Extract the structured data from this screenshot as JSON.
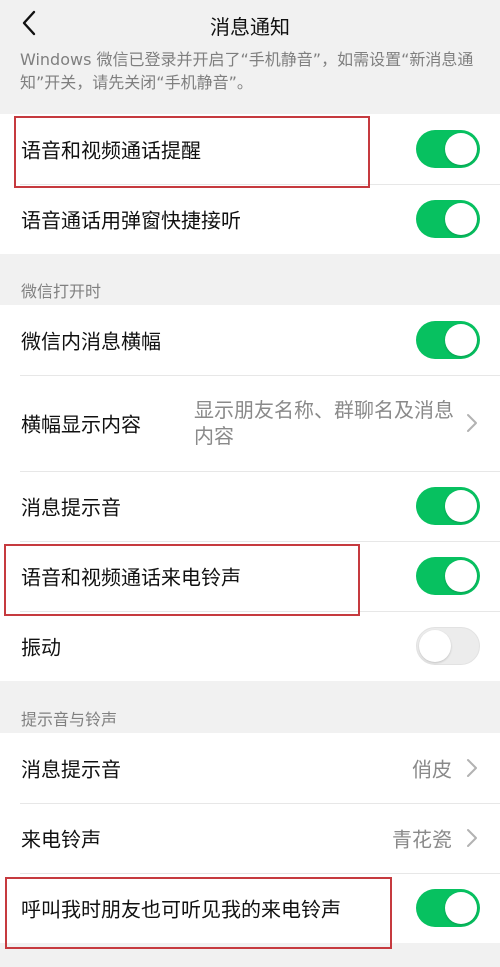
{
  "header": {
    "title": "消息通知",
    "back_icon": "chevron-left-icon"
  },
  "notice": "Windows 微信已登录并开启了“手机静音”，如需设置“新消息通知”开关，请先关闭“手机静音”。",
  "group1": {
    "items": [
      {
        "label": "语音和视频通话提醒",
        "toggle": "on"
      },
      {
        "label": "语音通话用弹窗快捷接听",
        "toggle": "on"
      }
    ]
  },
  "section_wechat_open": {
    "label": "微信打开时",
    "items": [
      {
        "label": "微信内消息横幅",
        "toggle": "on"
      },
      {
        "label": "横幅显示内容",
        "value": "显示朋友名称、群聊名及消息内容"
      },
      {
        "label": "消息提示音",
        "toggle": "on"
      },
      {
        "label": "语音和视频通话来电铃声",
        "toggle": "on"
      },
      {
        "label": "振动",
        "toggle": "off"
      }
    ]
  },
  "section_sounds": {
    "label": "提示音与铃声",
    "items": [
      {
        "label": "消息提示音",
        "value": "俏皮"
      },
      {
        "label": "来电铃声",
        "value": "青花瓷"
      },
      {
        "label": "呼叫我时朋友也可听见我的来电铃声",
        "toggle": "on"
      }
    ]
  },
  "colors": {
    "toggle_on": "#07c160",
    "highlight_box": "#c63a3f"
  }
}
